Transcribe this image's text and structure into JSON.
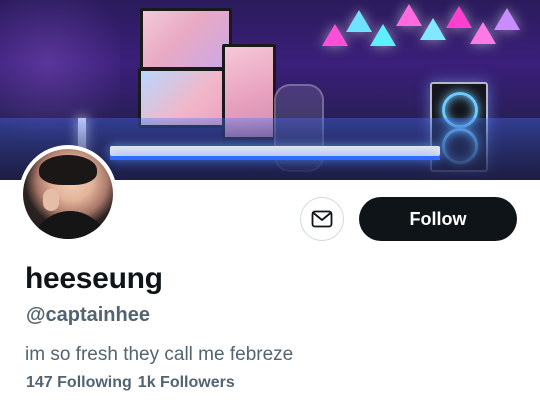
{
  "profile": {
    "display_name": "heeseung",
    "handle": "@captainhee",
    "bio": "im so fresh they call me febreze",
    "following_label": "147 Following",
    "followers_label": "1k Followers"
  },
  "actions": {
    "follow_label": "Follow",
    "message_icon": "envelope-icon"
  },
  "colors": {
    "primary_text": "#0f1419",
    "secondary_text": "#536471",
    "follow_button_bg": "#0f1419",
    "follow_button_text": "#ffffff",
    "border": "#cfd9de"
  }
}
